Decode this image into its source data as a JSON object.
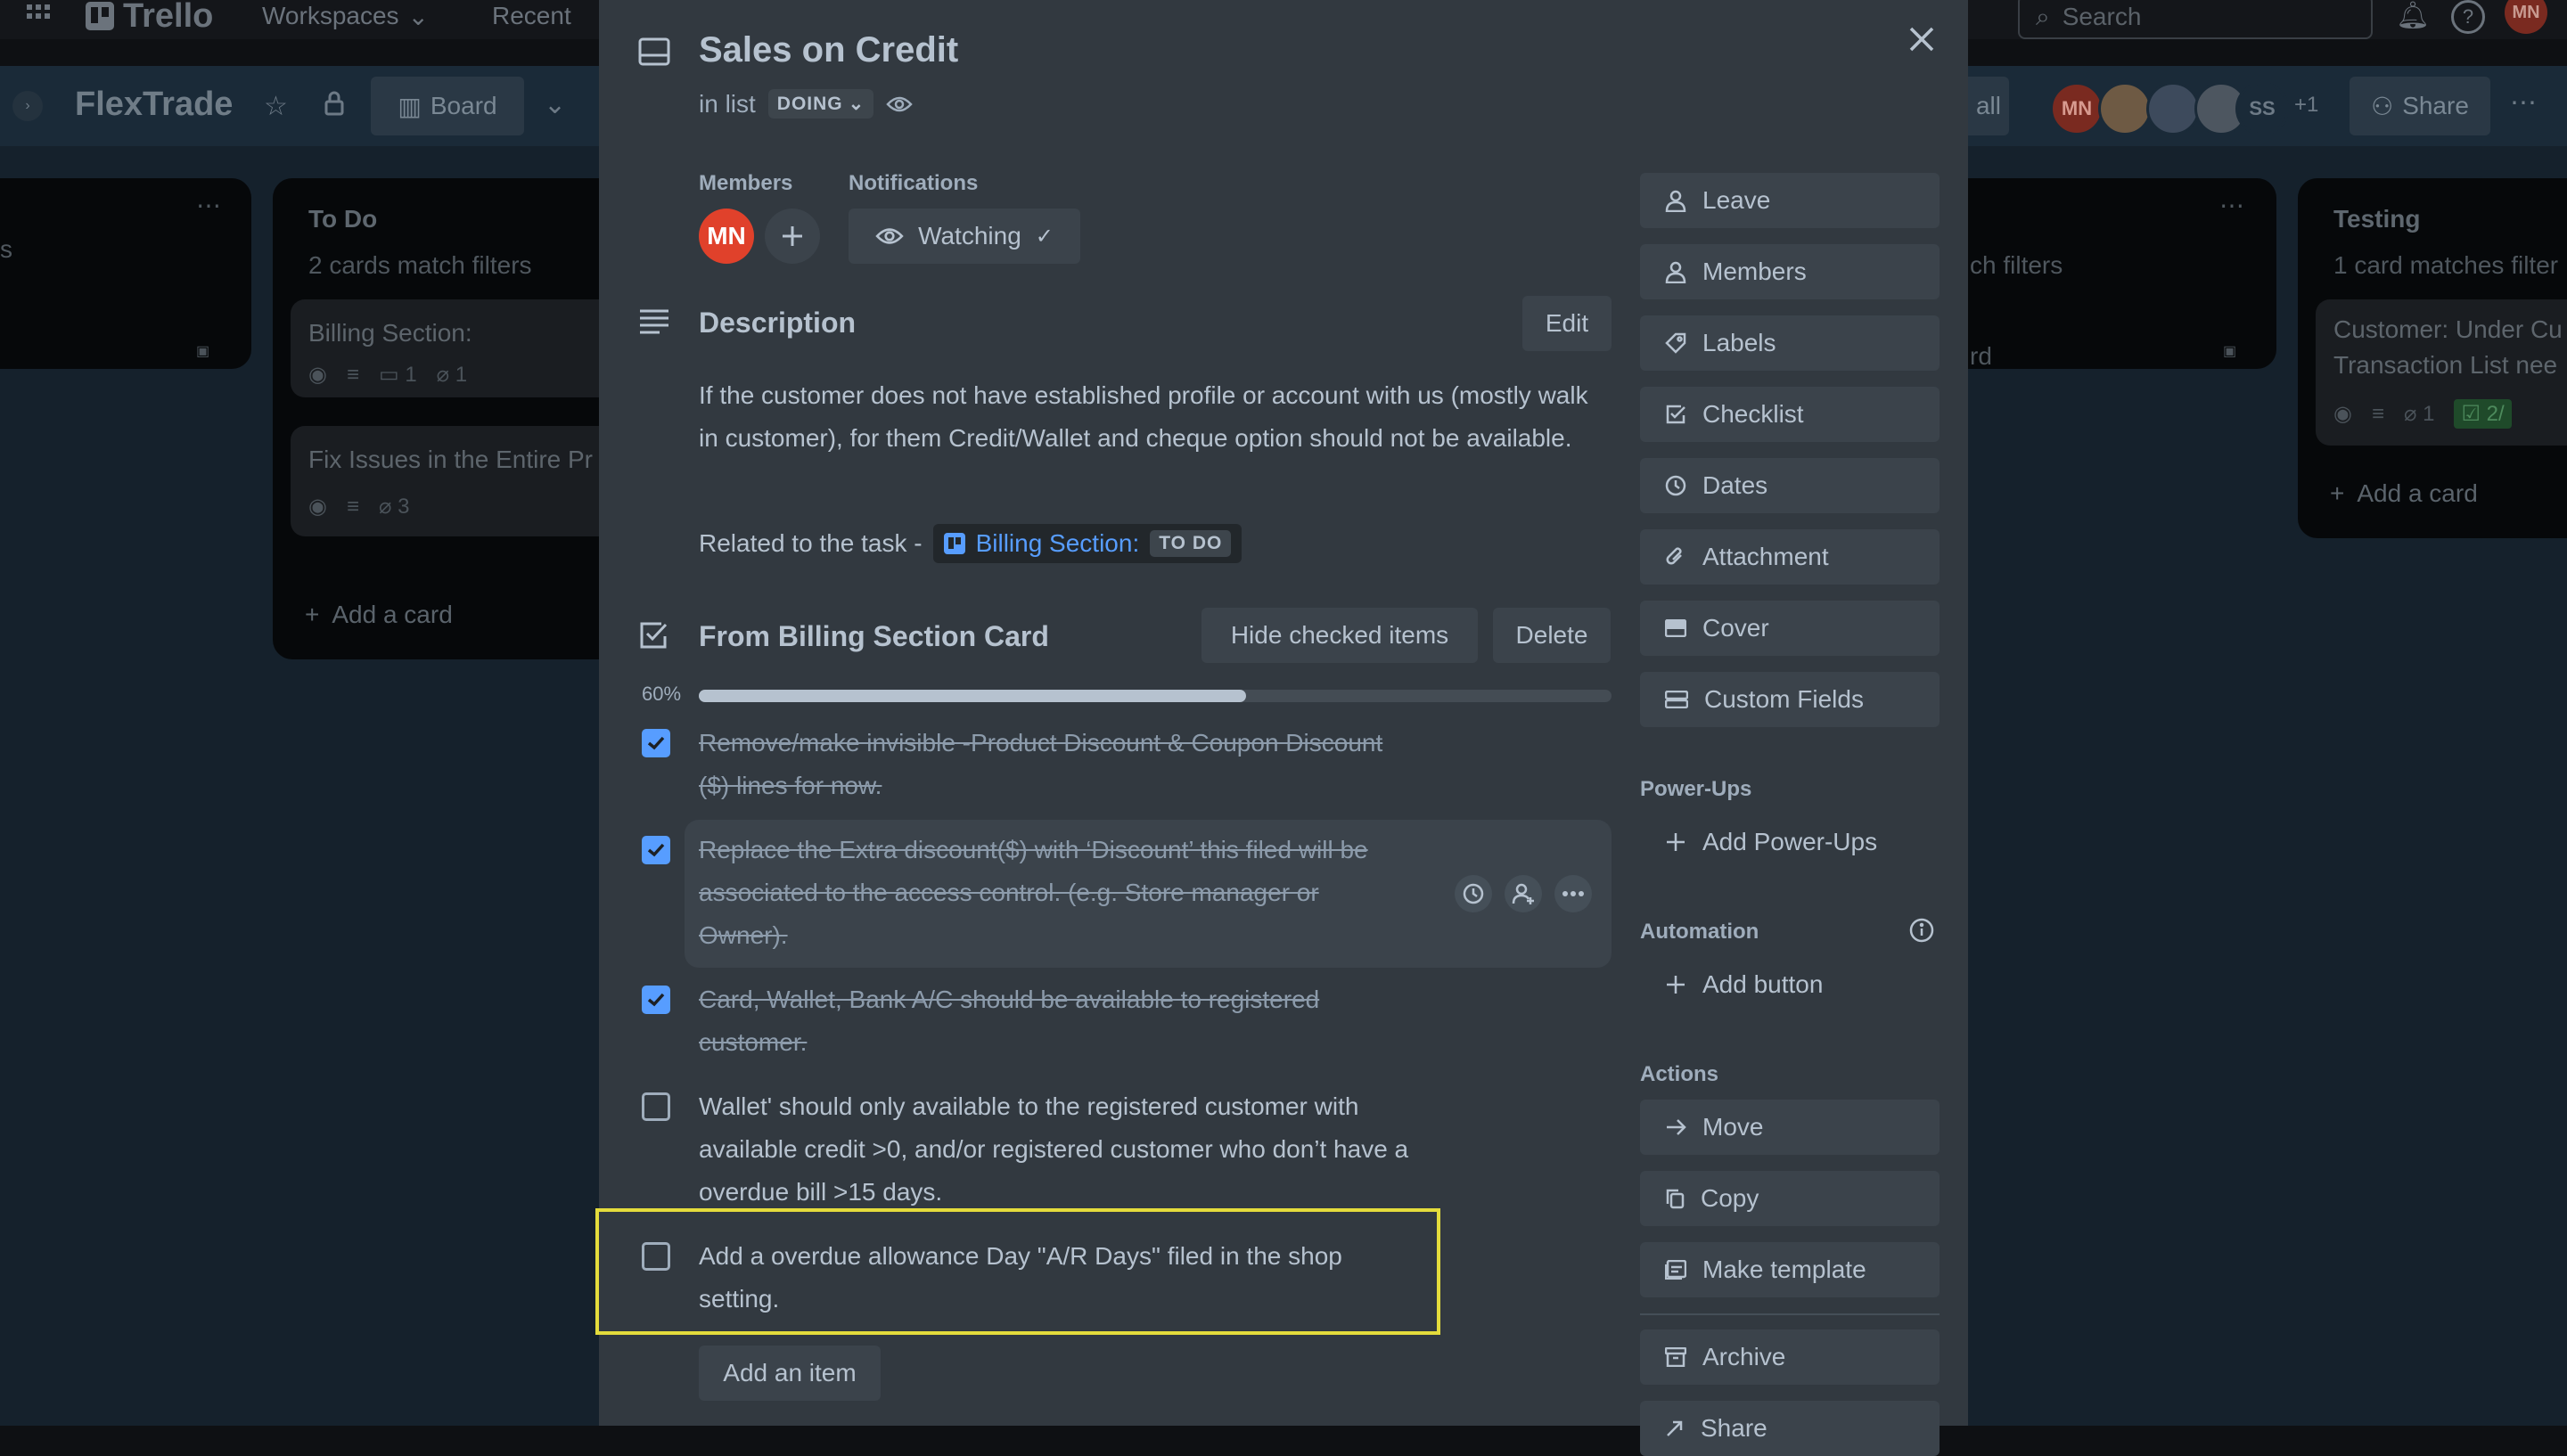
{
  "topbar": {
    "app_name": "Trello",
    "workspaces_label": "Workspaces",
    "recent_label": "Recent",
    "search_placeholder": "Search",
    "user_initials": "MN"
  },
  "boardbar": {
    "board_name": "FlexTrade",
    "view_label": "Board",
    "filter_fragment": "all",
    "share_label": "Share",
    "extra_members": "+1",
    "members": [
      "MN",
      "",
      "",
      "",
      "SS"
    ]
  },
  "board": {
    "lists": [
      {
        "title": "",
        "items": []
      },
      {
        "title": "To Do",
        "subtitle": "2 cards match filters",
        "cards": [
          {
            "title": "Billing Section:",
            "comments": "1",
            "attachments": "1"
          },
          {
            "title": "Fix Issues in the Entire Pr",
            "attachments": "3"
          }
        ],
        "add_card": "Add a card"
      },
      {
        "title": "",
        "subtitle_fragment": "ch filters",
        "card_fragment": "rd"
      },
      {
        "title": "Testing",
        "subtitle": "1 card matches filter",
        "cards": [
          {
            "title_line1": "Customer: Under Cu",
            "title_line2": "Transaction List nee",
            "attachments": "1",
            "checklist": "2/"
          }
        ],
        "add_card": "Add a card"
      }
    ]
  },
  "modal": {
    "title": "Sales on Credit",
    "in_list_prefix": "in list",
    "list_name": "DOING",
    "members_label": "Members",
    "member_initials": "MN",
    "notifications_label": "Notifications",
    "watching_label": "Watching",
    "description_title": "Description",
    "edit_label": "Edit",
    "description_text": "If the customer does not have established profile or account with us (mostly walk in customer), for them Credit/Wallet and cheque option should not be available.",
    "related_prefix": "Related to the task -",
    "related_link": "Billing Section:",
    "related_status": "TO DO",
    "checklist_title": "From Billing Section Card",
    "hide_checked_label": "Hide checked items",
    "delete_label": "Delete",
    "progress_label": "60%",
    "progress_value": 0.6,
    "items": [
      {
        "text_l1": "Remove/make invisible -Product Discount & Coupon Discount",
        "text_l2": "($) lines for now.",
        "checked": true
      },
      {
        "text_l1": "Replace the Extra discount($) with ‘Discount’ this filed will be",
        "text_l2": "associated to the access control. (e.g. Store manager or",
        "text_l3": "Owner).",
        "checked": true
      },
      {
        "text_l1": "Card, Wallet, Bank A/C should be available to registered",
        "text_l2": "customer.",
        "checked": true
      },
      {
        "text_l1": "Wallet' should only available to the registered customer with",
        "text_l2": "available credit >0, and/or registered customer who don’t have a",
        "text_l3": "overdue bill >15 days.",
        "checked": false
      },
      {
        "text_l1": "Add a overdue allowance Day \"A/R Days\" filed in the shop",
        "text_l2": "setting.",
        "checked": false
      }
    ],
    "add_item_label": "Add an item",
    "sidebar": {
      "leave": "Leave",
      "members": "Members",
      "labels": "Labels",
      "checklist": "Checklist",
      "dates": "Dates",
      "attachment": "Attachment",
      "cover": "Cover",
      "custom_fields": "Custom Fields",
      "powerups_label": "Power-Ups",
      "add_powerups": "Add Power-Ups",
      "automation_label": "Automation",
      "add_button": "Add button",
      "actions_label": "Actions",
      "move": "Move",
      "copy": "Copy",
      "make_template": "Make template",
      "archive": "Archive",
      "share": "Share"
    }
  },
  "colors": {
    "accent": "#579dff",
    "avatar_red": "#e0412b",
    "highlight": "#e4dc3c"
  }
}
